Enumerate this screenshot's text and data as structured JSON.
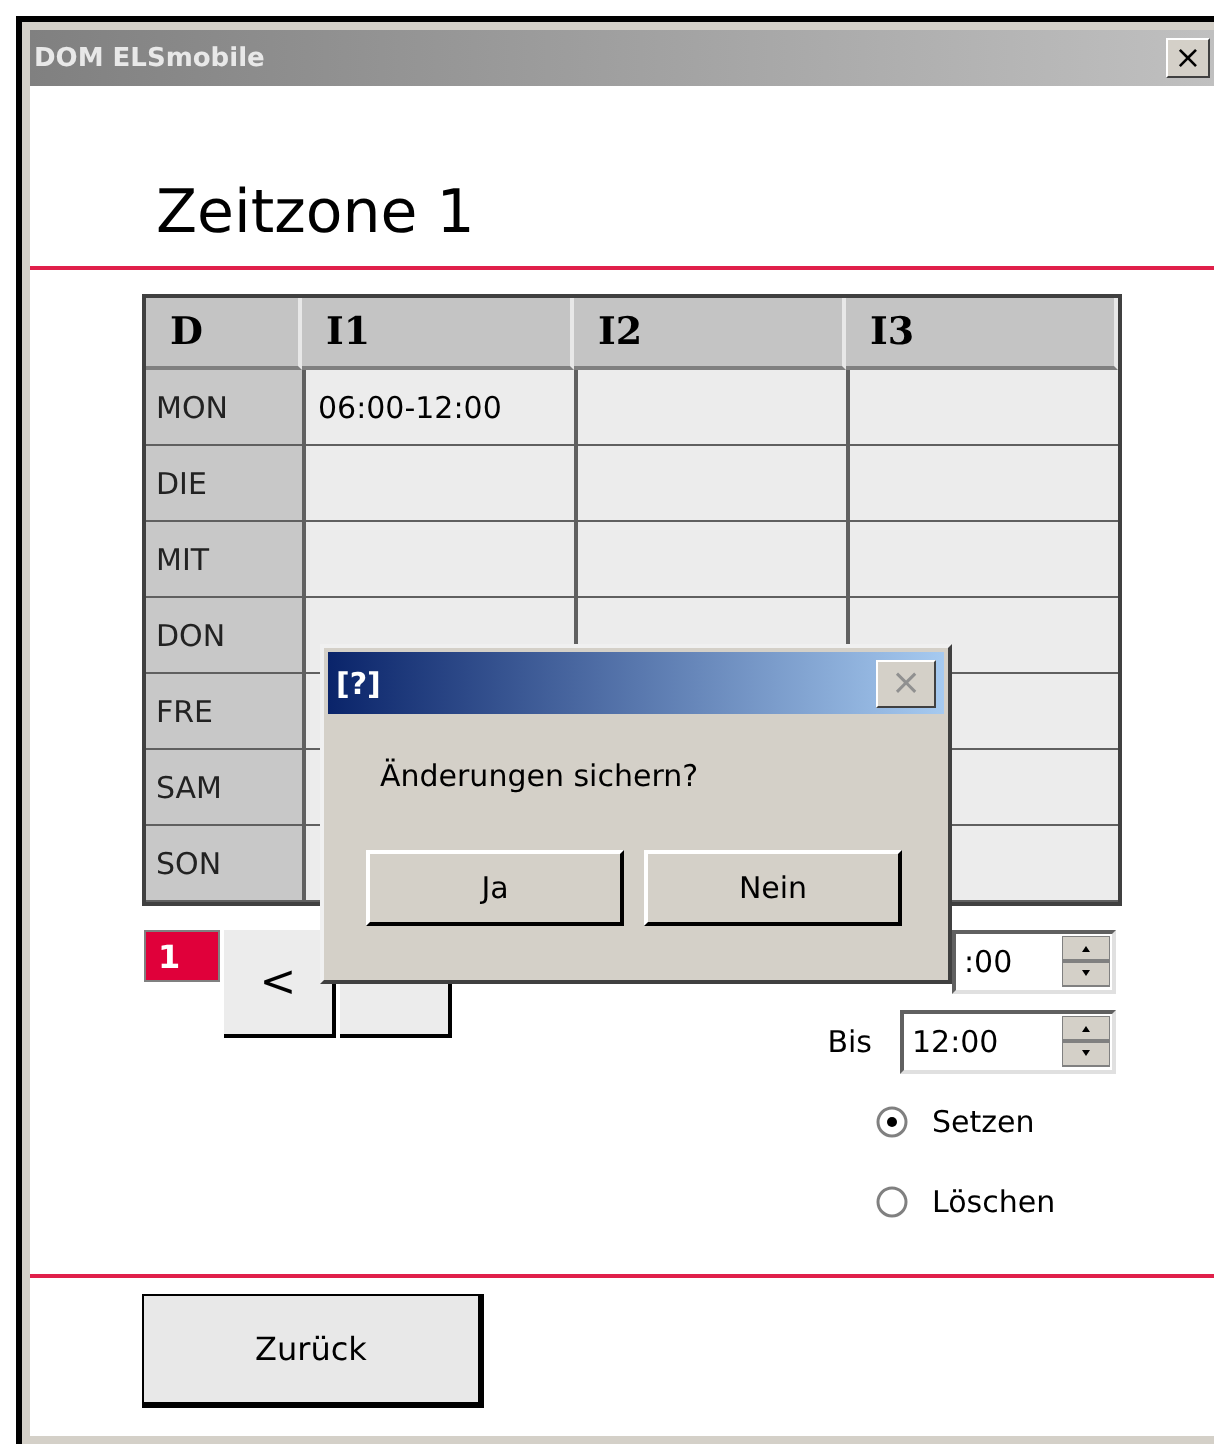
{
  "window": {
    "title": "DOM ELSmobile",
    "close": "×"
  },
  "heading": "Zeitzone 1",
  "table": {
    "columns": [
      "D",
      "I1",
      "I2",
      "I3"
    ],
    "rows": [
      [
        "MON",
        "06:00-12:00",
        "",
        ""
      ],
      [
        "DIE",
        "",
        "",
        ""
      ],
      [
        "MIT",
        "",
        "",
        ""
      ],
      [
        "DON",
        "",
        "",
        ""
      ],
      [
        "FRE",
        "",
        "",
        ""
      ],
      [
        "SAM",
        "",
        "",
        ""
      ],
      [
        "SON",
        "",
        "",
        ""
      ]
    ]
  },
  "zone_badge": "1",
  "prev_button": "<",
  "from_field": {
    "value": ":00"
  },
  "to_field": {
    "label": "Bis",
    "value": "12:00"
  },
  "radios": [
    {
      "label": "Setzen",
      "selected": true
    },
    {
      "label": "Löschen",
      "selected": false
    }
  ],
  "back_button": "Zurück",
  "dialog": {
    "title": "[?]",
    "close": "×",
    "message": "Änderungen sichern?",
    "buttons": [
      "Ja",
      "Nein"
    ]
  }
}
